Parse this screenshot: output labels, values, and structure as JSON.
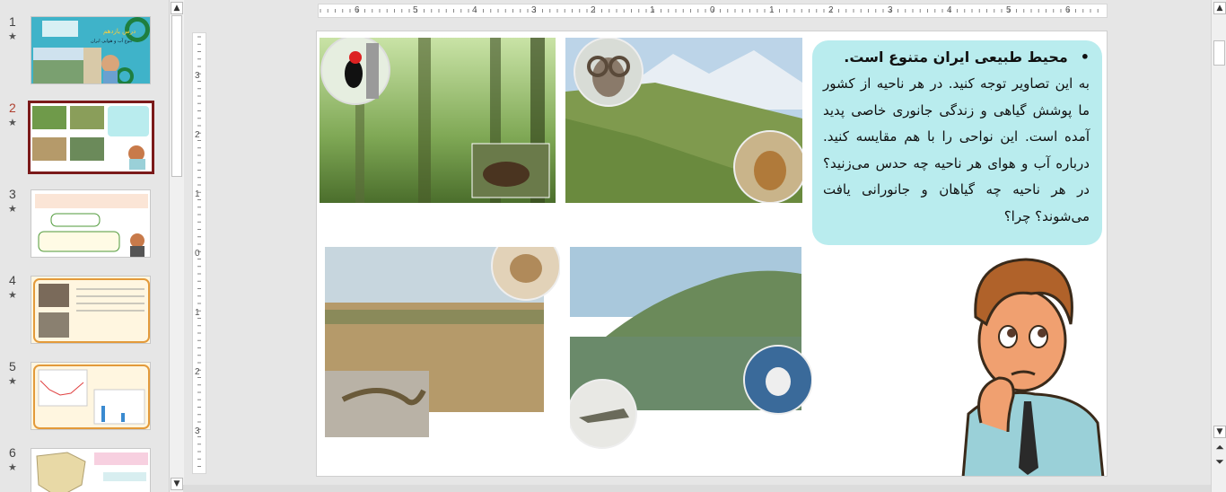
{
  "thumbnails": [
    {
      "number": "1",
      "star": "★",
      "selected": false,
      "title": "درس یازدهم",
      "subtitle": "تنوع آب و هوایی ایران"
    },
    {
      "number": "2",
      "star": "★",
      "selected": true
    },
    {
      "number": "3",
      "star": "★",
      "selected": false
    },
    {
      "number": "4",
      "star": "★",
      "selected": false
    },
    {
      "number": "5",
      "star": "★",
      "selected": false
    },
    {
      "number": "6",
      "star": "★",
      "selected": false
    }
  ],
  "ruler": {
    "horizontal_labels": [
      "6",
      "5",
      "4",
      "3",
      "2",
      "1",
      "0",
      "1",
      "2",
      "3",
      "4",
      "5",
      "6"
    ],
    "vertical_labels": [
      "3",
      "2",
      "1",
      "0",
      "1",
      "2",
      "3"
    ]
  },
  "slide": {
    "bullet": "•",
    "title": "محیط طبیعی ایران متنوع است.",
    "body": "به این تصاویر توجه کنید. در هر ناحیه از کشور ما پوشش گیاهی و زندگی جانوری خاصی پدید آمده است. این نواحی را با هم مقایسه کنید. درباره آب و هوای هر ناحیه چه حدس می‌زنید؟ در هر ناحیه چه گیاهان و جانورانی یافت می‌شوند؟ چرا؟",
    "photos": [
      {
        "name": "forest-photo",
        "color": "#6f9a4a"
      },
      {
        "name": "mountain-pasture-photo",
        "color": "#7f9a4e"
      },
      {
        "name": "desert-photo",
        "color": "#b59a6a"
      },
      {
        "name": "mangrove-coast-photo",
        "color": "#6b8a5a"
      }
    ]
  },
  "scroll": {
    "up": "▲",
    "down": "▼",
    "prev": "⏶",
    "next": "⏷"
  }
}
